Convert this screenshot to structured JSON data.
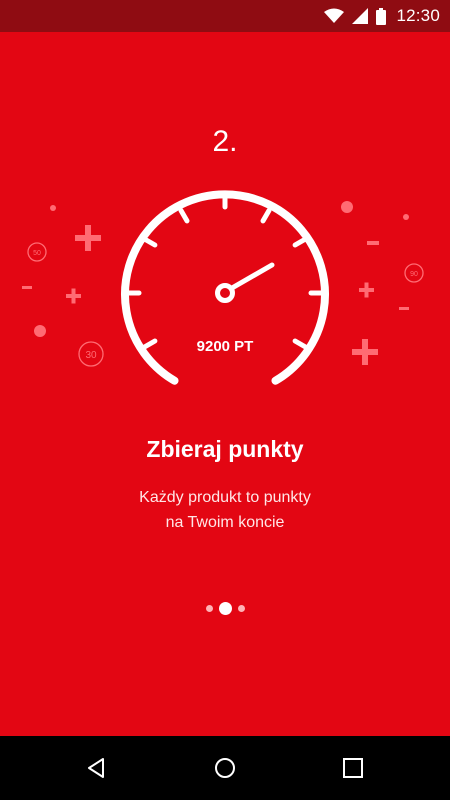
{
  "status_bar": {
    "time": "12:30",
    "icons": [
      "wifi-icon",
      "signal-icon",
      "battery-icon"
    ]
  },
  "onboarding": {
    "step": "2.",
    "gauge_value": "9200 PT",
    "gauge_labels": [
      "50",
      "30",
      "90"
    ],
    "title": "Zbieraj punkty",
    "subtitle_lines": [
      "Każdy produkt to punkty",
      "na Twoim koncie"
    ],
    "pager": {
      "pages": 3,
      "current": 2
    }
  },
  "navigation": {
    "buttons": [
      "back-icon",
      "home-icon",
      "recents-icon"
    ]
  },
  "colors": {
    "background": "#e30613",
    "status_bar": "#8f0c12",
    "nav_bar": "#000000",
    "decor": "#ff6b73"
  }
}
